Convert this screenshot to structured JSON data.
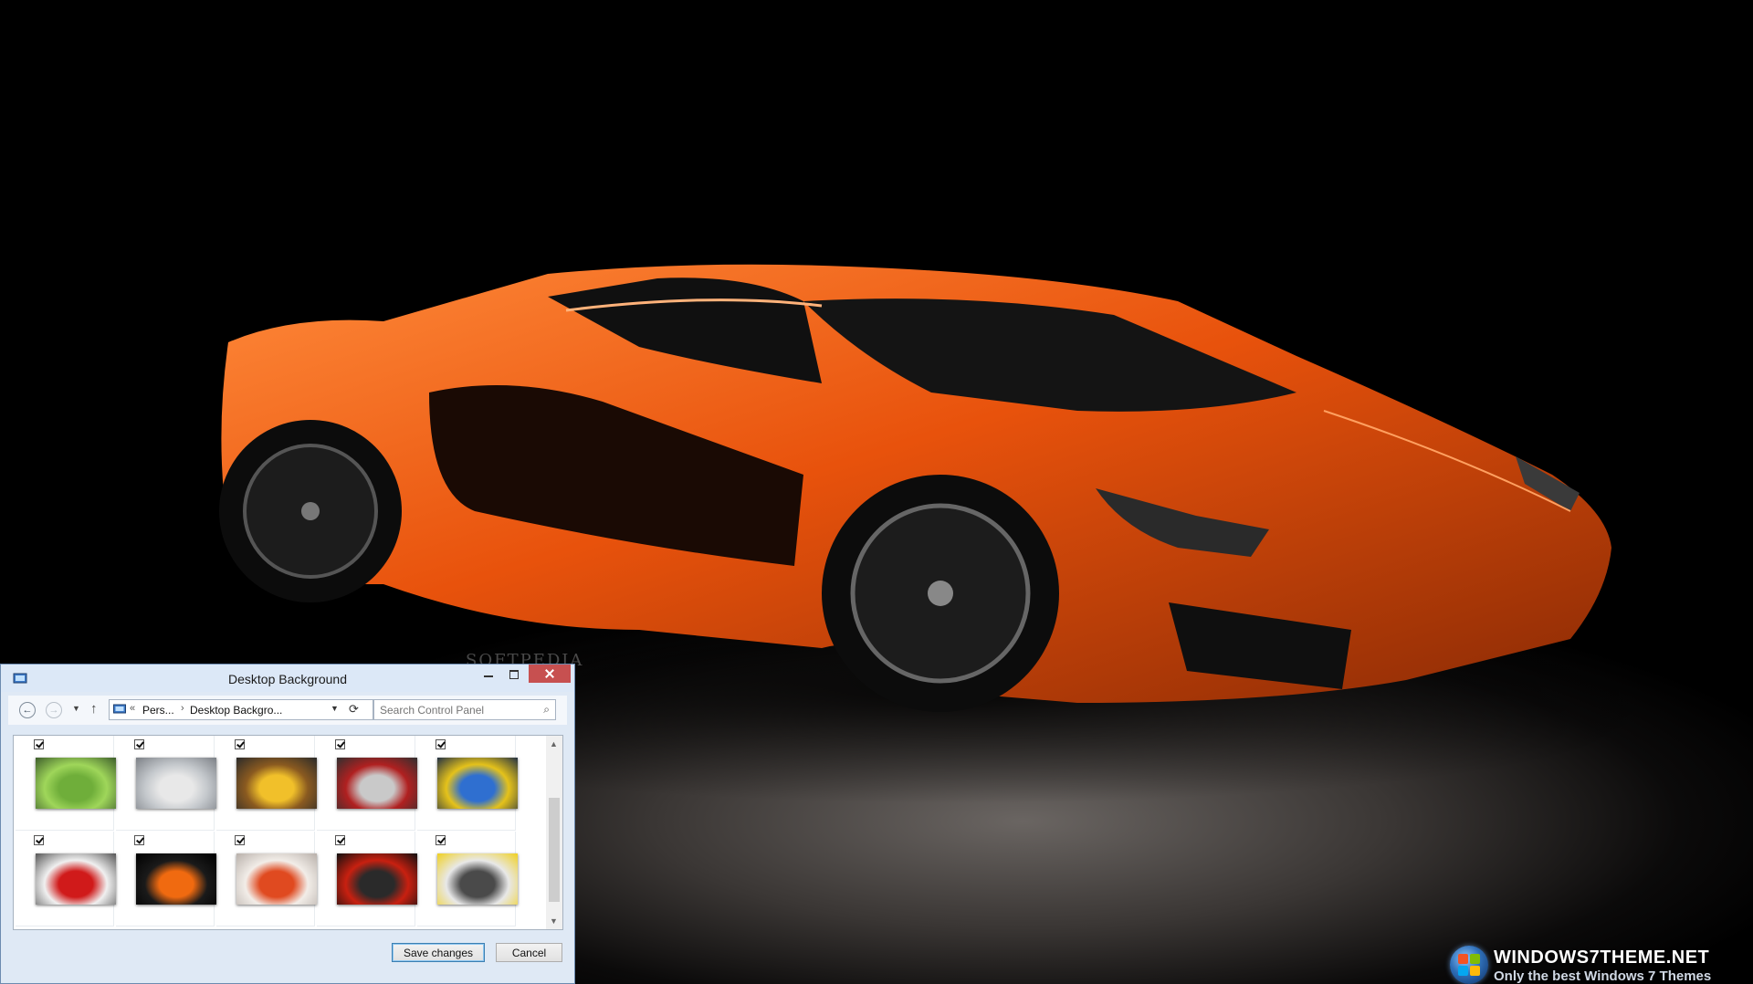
{
  "window": {
    "title": "Desktop Background",
    "address": {
      "separator": "«",
      "crumb1": "Pers...",
      "crumb2": "Desktop Backgro..."
    },
    "search": {
      "placeholder": "Search Control Panel"
    },
    "pictures": [
      {
        "checked": true,
        "colors": [
          "#6fae3a",
          "#9fd65a",
          "#3d5d2b"
        ]
      },
      {
        "checked": true,
        "colors": [
          "#e8e8e8",
          "#c4c8cc",
          "#7c8086"
        ]
      },
      {
        "checked": true,
        "colors": [
          "#f1c02a",
          "#8a5a20",
          "#2a2a2a"
        ]
      },
      {
        "checked": true,
        "colors": [
          "#c9c9c9",
          "#b02020",
          "#303030"
        ]
      },
      {
        "checked": true,
        "colors": [
          "#2f6fd0",
          "#e5c21a",
          "#223044"
        ]
      },
      {
        "checked": true,
        "colors": [
          "#d01a1a",
          "#f0f0f0",
          "#555555"
        ]
      },
      {
        "checked": true,
        "colors": [
          "#f06a10",
          "#1a1a1a",
          "#000000"
        ]
      },
      {
        "checked": true,
        "colors": [
          "#e04a20",
          "#f2ede8",
          "#b8b0aa"
        ]
      },
      {
        "checked": true,
        "colors": [
          "#2a2a2a",
          "#c82010",
          "#101010"
        ]
      },
      {
        "checked": true,
        "colors": [
          "#4a4a4a",
          "#e8e8e8",
          "#f0d020"
        ]
      }
    ],
    "buttons": {
      "save": "Save changes",
      "cancel": "Cancel"
    }
  },
  "desktop": {
    "watermark": "SOFTPEDIA",
    "logo_line1": "WINDOWS7THEME.NET",
    "logo_line2": "Only the best Windows 7 Themes",
    "car_color": "#e8520c"
  }
}
